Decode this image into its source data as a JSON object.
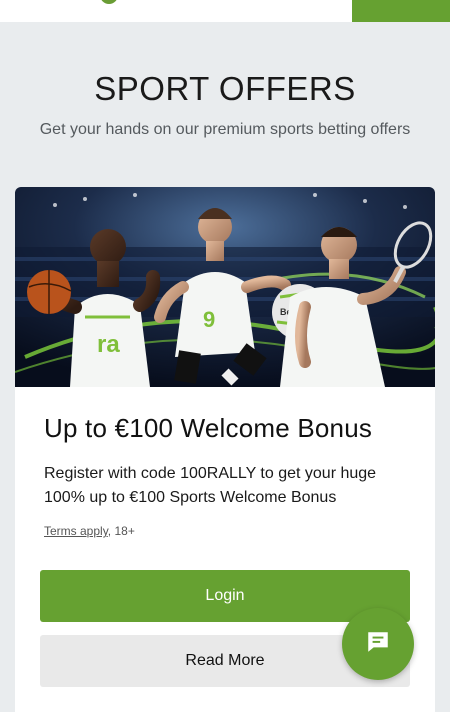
{
  "header": {
    "accent_color": "#66a131"
  },
  "hero": {
    "title": "SPORT OFFERS",
    "subtitle": "Get your hands on our premium sports betting offers"
  },
  "offer": {
    "image_alt": "Basketball, football and tennis players",
    "ball_brand": "Betrally",
    "jersey_number": "9",
    "title": "Up to €100 Welcome Bonus",
    "description": "Register with code 100RALLY to get your huge 100% up to €100 Sports Welcome Bonus",
    "terms_link": "Terms apply",
    "terms_suffix": ", 18+",
    "login_label": "Login",
    "read_more_label": "Read More"
  },
  "chat": {
    "icon": "chat-bubble-icon"
  }
}
